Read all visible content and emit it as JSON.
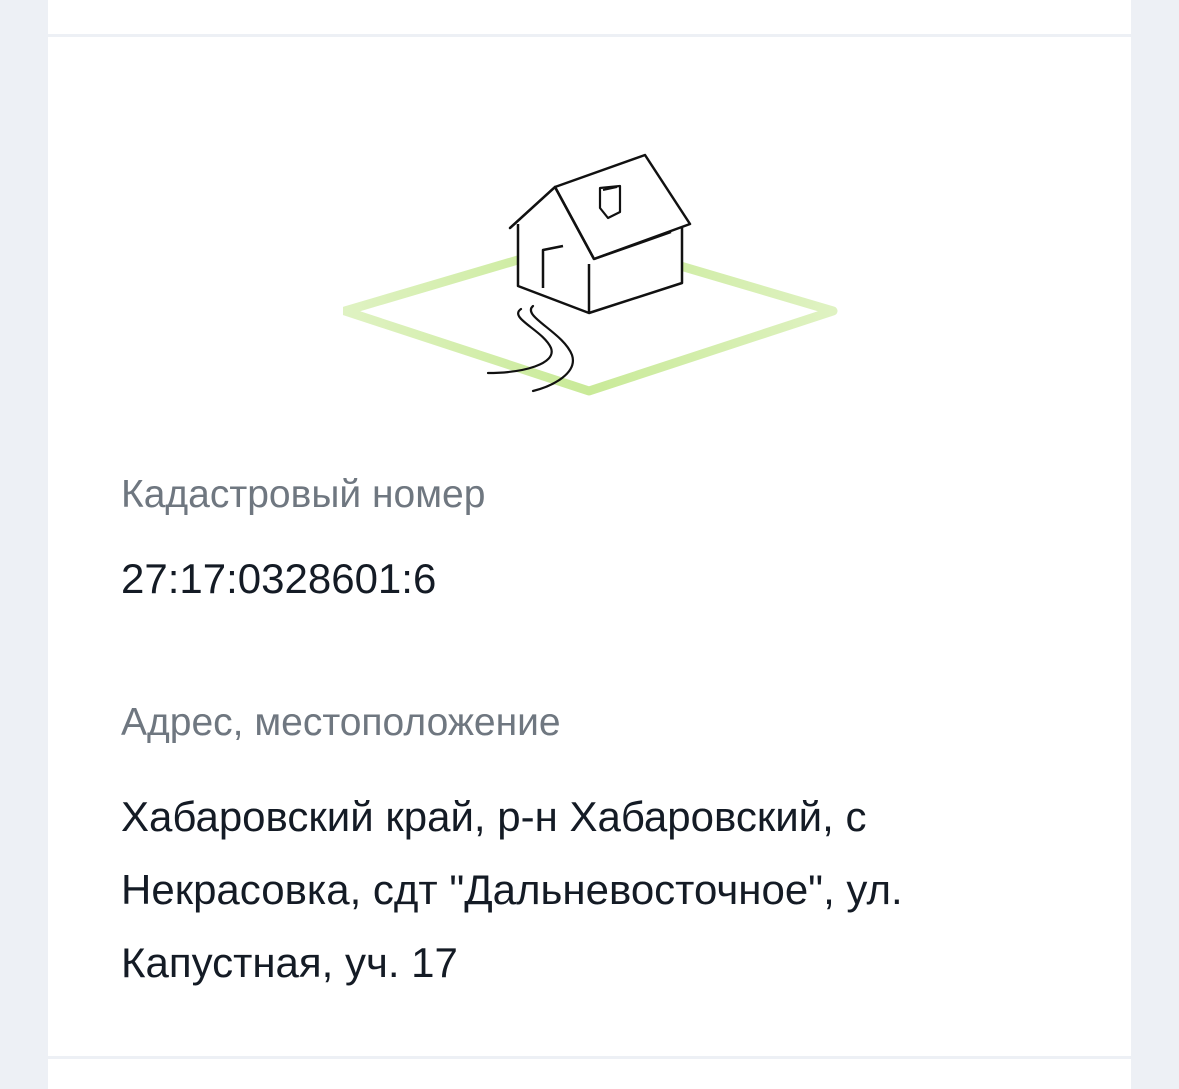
{
  "cadastral": {
    "label": "Кадастровый номер",
    "value": "27:17:0328601:6"
  },
  "address": {
    "label": "Адрес, местоположение",
    "lines": [
      "Хабаровский край, р-н Хабаровский, с",
      "Некрасовка, сдт \"Дальневосточное\", ул.",
      "Капустная, уч. 17"
    ]
  },
  "colors": {
    "plot_outline": "#d8efb0",
    "label_text": "#6f7780",
    "value_text": "#141b25"
  },
  "illustration": {
    "icon": "house-on-plot-icon"
  }
}
